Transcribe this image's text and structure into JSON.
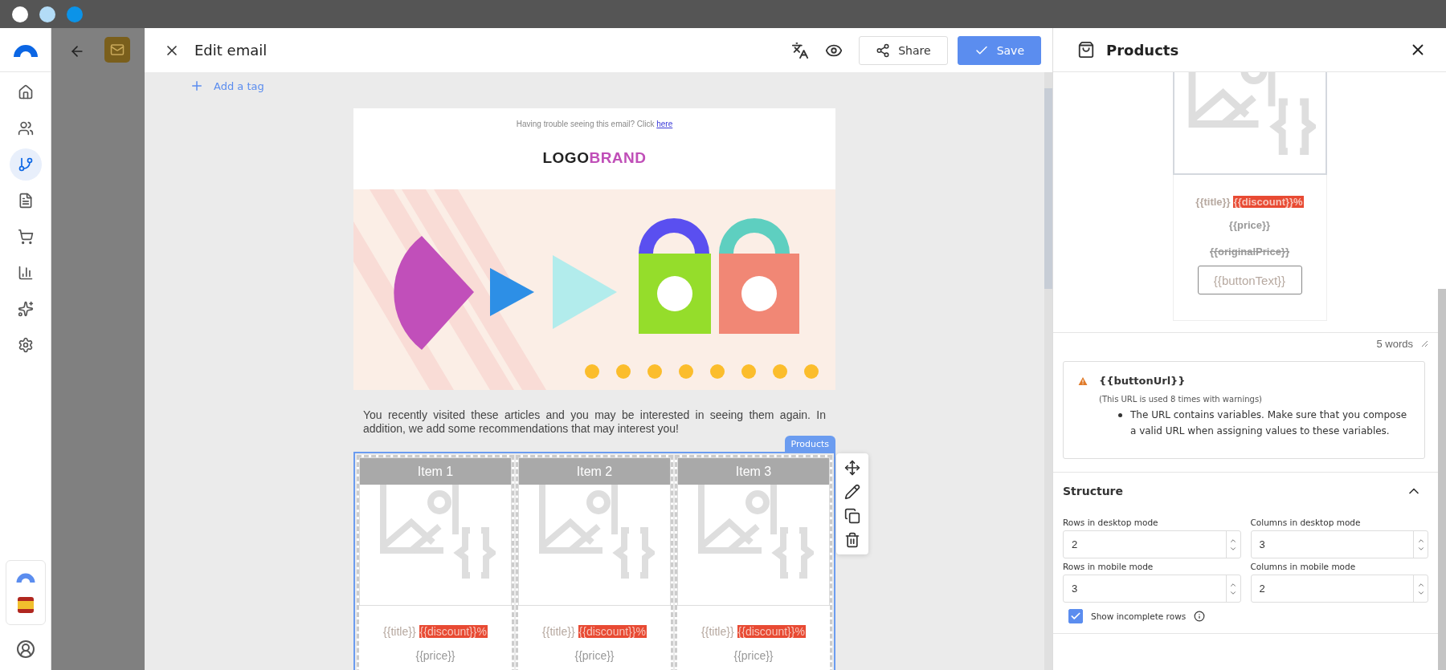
{
  "sidebar": {
    "items": [
      {
        "kind": "home",
        "selected": false
      },
      {
        "kind": "contacts",
        "selected": false
      },
      {
        "kind": "automation",
        "selected": true
      },
      {
        "kind": "documents",
        "selected": false
      },
      {
        "kind": "cart",
        "selected": false
      },
      {
        "kind": "stats",
        "selected": false
      },
      {
        "kind": "ai",
        "selected": false
      },
      {
        "kind": "settings",
        "selected": false
      }
    ]
  },
  "editor": {
    "title": "Edit email",
    "share": "Share",
    "save": "Save",
    "add_tag": "Add a tag"
  },
  "email": {
    "preheader": "Having trouble seeing this email? Click",
    "preheader_link": "here",
    "logo_first": "LOGO",
    "logo_second": "BRAND",
    "body_text": "You recently visited these articles and you may be interested in seeing them again. In addition, we add some recommendations that may interest you!",
    "block_tag": "Products",
    "items": [
      {
        "header": "Item 1",
        "title": "{{title}}",
        "discount": "{{discount}}%",
        "price": "{{price}}"
      },
      {
        "header": "Item 2",
        "title": "{{title}}",
        "discount": "{{discount}}%",
        "price": "{{price}}"
      },
      {
        "header": "Item 3",
        "title": "{{title}}",
        "discount": "{{discount}}%",
        "price": "{{price}}"
      }
    ]
  },
  "panel": {
    "title": "Products",
    "card": {
      "title": "{{title}}",
      "discount": "{{discount}}%",
      "price": "{{price}}",
      "original_price": "{{originalPrice}}",
      "button": "{{buttonText}}"
    },
    "word_count": "5 words",
    "warning": {
      "url": "{{buttonUrl}}",
      "note": "(This URL is used 8 times with warnings)",
      "bullets": [
        "The URL contains variables. Make sure that you compose a valid URL when assigning values to these variables."
      ]
    },
    "structure": {
      "title": "Structure",
      "expanded": true,
      "fields": [
        {
          "label": "Rows in desktop mode",
          "value": "2"
        },
        {
          "label": "Columns in desktop mode",
          "value": "3"
        },
        {
          "label": "Rows in mobile mode",
          "value": "3"
        },
        {
          "label": "Columns in mobile mode",
          "value": "2"
        }
      ],
      "show_incomplete": {
        "label": "Show incomplete rows",
        "checked": true
      }
    }
  }
}
